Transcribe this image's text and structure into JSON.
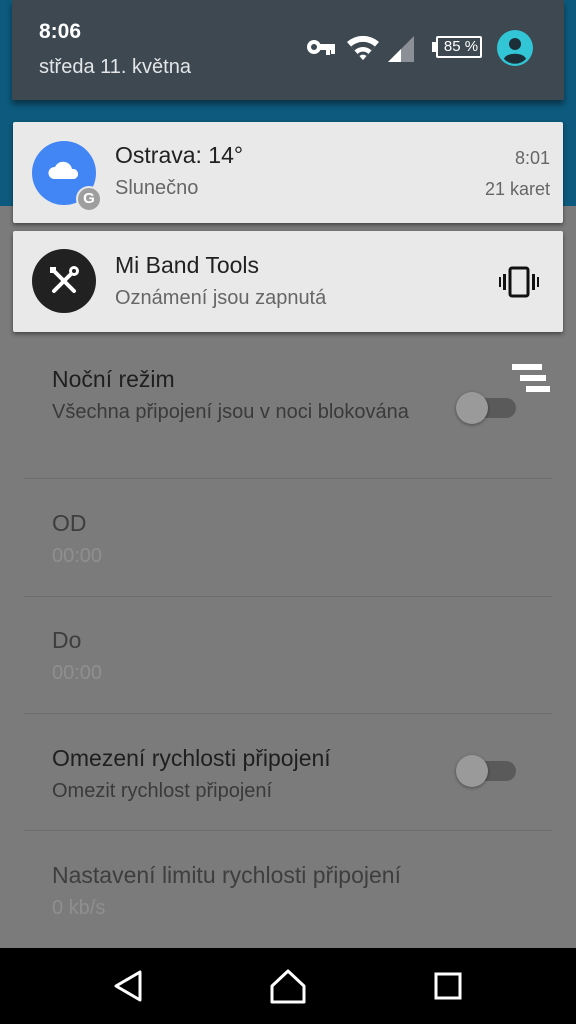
{
  "status_bar": {
    "time": "8:06",
    "date": "středa 11. května",
    "battery_percent": "85 %",
    "icons": [
      "vpn-key-icon",
      "wifi-icon",
      "cellular-signal-icon",
      "battery-icon",
      "user-avatar-icon"
    ]
  },
  "notifications": [
    {
      "title": "Ostrava: 14°",
      "text": "Slunečno",
      "time": "8:01",
      "meta": "21 karet",
      "icon": "cloud-icon",
      "badge": "G",
      "accent": "#4285f4"
    },
    {
      "title": "Mi Band Tools",
      "text": "Oznámení jsou zapnutá",
      "icon": "tools-icon",
      "action_icon": "vibrate-icon",
      "accent": "#212121"
    }
  ],
  "settings": [
    {
      "title": "Noční režim",
      "subtitle": "Všechna připojení jsou v noci blokována",
      "toggle": false
    },
    {
      "title": "OD",
      "subtitle": "00:00"
    },
    {
      "title": "Do",
      "subtitle": "00:00"
    },
    {
      "title": "Omezení rychlosti připojení",
      "subtitle": "Omezit rychlost připojení",
      "toggle": false
    },
    {
      "title": "Nastavení limitu rychlosti připojení",
      "subtitle": "0 kb/s"
    }
  ],
  "navigation": [
    "back-icon",
    "home-icon",
    "recents-icon"
  ],
  "colors": {
    "shade": "#3e4850",
    "app_header": "#0d5a7e",
    "avatar": "#31c5d6",
    "weather": "#4285f4"
  }
}
